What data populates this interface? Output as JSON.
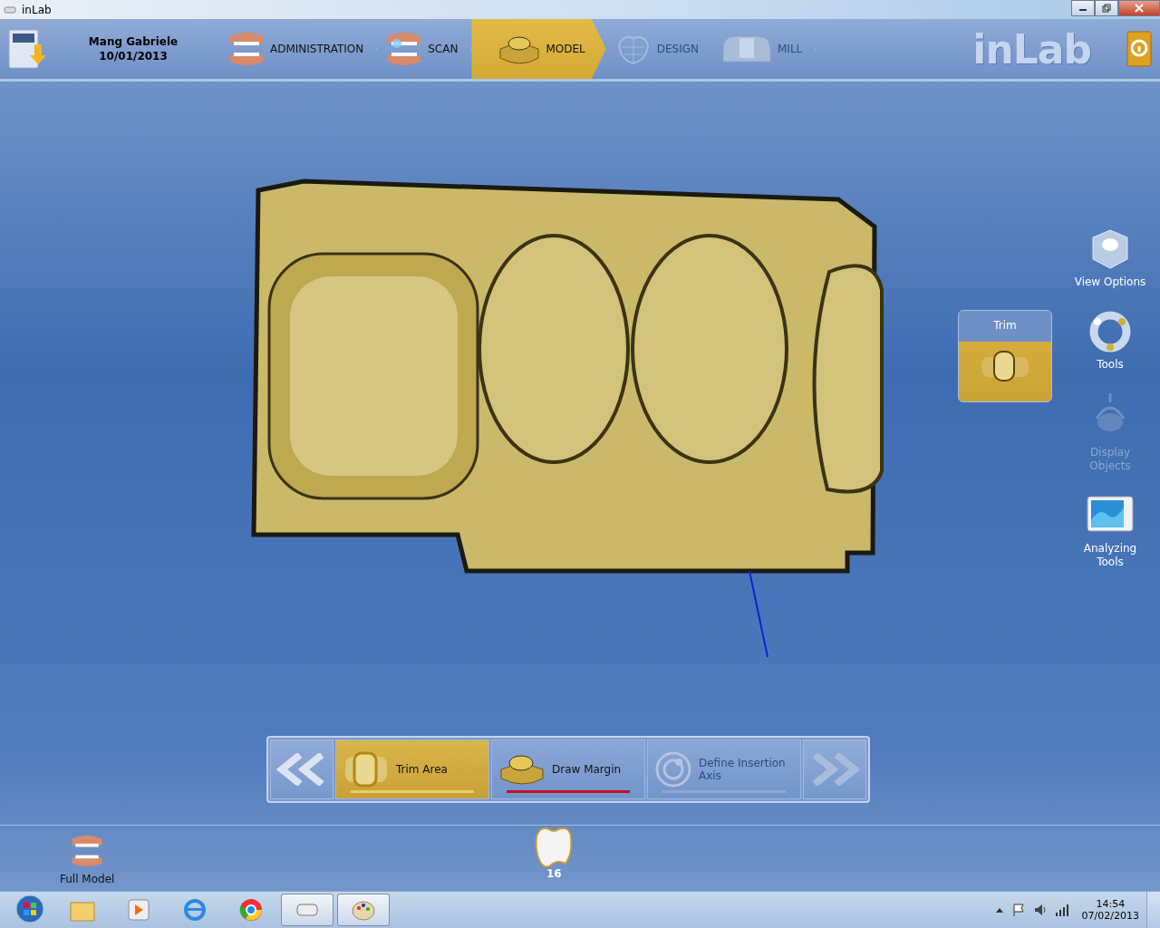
{
  "window": {
    "title": "inLab"
  },
  "header": {
    "patient": "Mang Gabriele",
    "date": "10/01/2013",
    "logo": "inLab",
    "phases": [
      {
        "kind": "admin",
        "label": "ADMINISTRATION",
        "selected": false,
        "disabled": false
      },
      {
        "kind": "scan",
        "label": "SCAN",
        "selected": false,
        "disabled": false
      },
      {
        "kind": "model",
        "label": "MODEL",
        "selected": true,
        "disabled": false
      },
      {
        "kind": "design",
        "label": "DESIGN",
        "selected": false,
        "disabled": true
      },
      {
        "kind": "mill",
        "label": "MILL",
        "selected": false,
        "disabled": true
      }
    ]
  },
  "trim_panel": {
    "title": "Trim"
  },
  "side_tools": [
    {
      "kind": "view",
      "label": "View Options",
      "disabled": false
    },
    {
      "kind": "tools",
      "label": "Tools",
      "disabled": false
    },
    {
      "kind": "display",
      "label": "Display Objects",
      "disabled": true
    },
    {
      "kind": "analyze",
      "label": "Analyzing Tools",
      "disabled": false
    }
  ],
  "steps": [
    {
      "kind": "trim",
      "label": "Trim Area",
      "completed": true,
      "selected": false,
      "disabled": false
    },
    {
      "kind": "margin",
      "label": "Draw Margin",
      "completed": false,
      "selected": true,
      "disabled": false
    },
    {
      "kind": "axis",
      "label": "Define Insertion Axis",
      "completed": false,
      "selected": false,
      "disabled": true
    }
  ],
  "bottom": {
    "full_model": "Full Model",
    "tooth": "16"
  },
  "taskbar": {
    "apps": [
      {
        "kind": "explorer",
        "open": false
      },
      {
        "kind": "media",
        "open": false
      },
      {
        "kind": "ie",
        "open": false
      },
      {
        "kind": "chrome",
        "open": false
      },
      {
        "kind": "inlab",
        "open": true
      },
      {
        "kind": "paint",
        "open": true
      }
    ],
    "time": "14:54",
    "date": "07/02/2013"
  }
}
